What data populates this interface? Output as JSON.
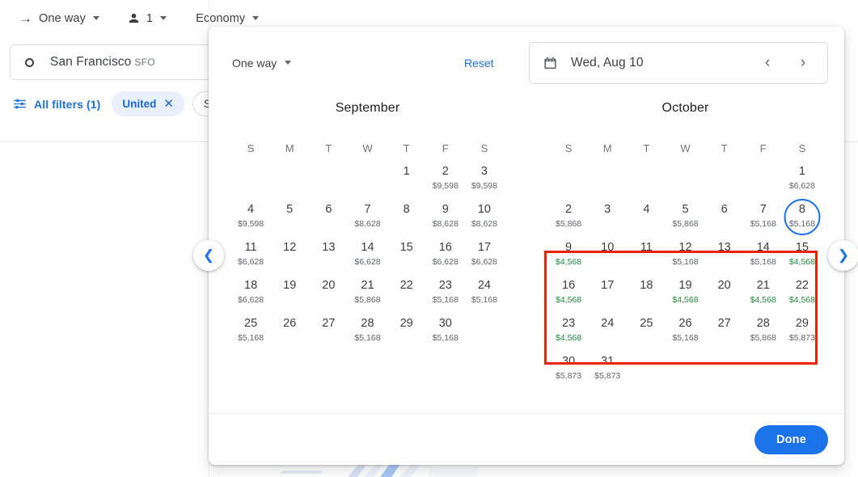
{
  "topbar": {
    "trip_type": "One way",
    "trip_type_icon": "arrow-right-icon",
    "passengers": "1",
    "passengers_icon": "person-icon",
    "cabin_class": "Economy"
  },
  "search": {
    "origin": "San Francisco",
    "origin_code": "SFO",
    "origin_icon": "circle-icon"
  },
  "filters": {
    "icon": "tune-icon",
    "all_filters_label": "All filters (1)",
    "chips": [
      {
        "label": "United",
        "close_icon": "close-icon",
        "active": true
      },
      {
        "label": "S",
        "active": false
      }
    ]
  },
  "dialog": {
    "trip_type": "One way",
    "reset_label": "Reset",
    "date_icon": "calendar-icon",
    "date_value": "Wed, Aug 10",
    "prev_icon": "chevron-left-icon",
    "next_icon": "chevron-right-icon",
    "done_label": "Done",
    "weekdays": [
      "S",
      "M",
      "T",
      "W",
      "T",
      "F",
      "S"
    ],
    "months": [
      {
        "name": "September",
        "lead_blanks": 4,
        "days": [
          {
            "day": "1",
            "price": ""
          },
          {
            "day": "2",
            "price": "$9,598"
          },
          {
            "day": "3",
            "price": "$9,598"
          },
          {
            "day": "4",
            "price": "$9,598"
          },
          {
            "day": "5",
            "price": ""
          },
          {
            "day": "6",
            "price": ""
          },
          {
            "day": "7",
            "price": "$8,628"
          },
          {
            "day": "8",
            "price": ""
          },
          {
            "day": "9",
            "price": "$8,628"
          },
          {
            "day": "10",
            "price": "$8,628"
          },
          {
            "day": "11",
            "price": "$6,628"
          },
          {
            "day": "12",
            "price": ""
          },
          {
            "day": "13",
            "price": ""
          },
          {
            "day": "14",
            "price": "$6,628"
          },
          {
            "day": "15",
            "price": ""
          },
          {
            "day": "16",
            "price": "$6,628"
          },
          {
            "day": "17",
            "price": "$6,628"
          },
          {
            "day": "18",
            "price": "$6,628"
          },
          {
            "day": "19",
            "price": ""
          },
          {
            "day": "20",
            "price": ""
          },
          {
            "day": "21",
            "price": "$5,868"
          },
          {
            "day": "22",
            "price": ""
          },
          {
            "day": "23",
            "price": "$5,168"
          },
          {
            "day": "24",
            "price": "$5,168"
          },
          {
            "day": "25",
            "price": "$5,168"
          },
          {
            "day": "26",
            "price": ""
          },
          {
            "day": "27",
            "price": ""
          },
          {
            "day": "28",
            "price": "$5,168"
          },
          {
            "day": "29",
            "price": ""
          },
          {
            "day": "30",
            "price": "$5,168"
          }
        ]
      },
      {
        "name": "October",
        "lead_blanks": 6,
        "days": [
          {
            "day": "1",
            "price": "$6,628"
          },
          {
            "day": "2",
            "price": "$5,868"
          },
          {
            "day": "3",
            "price": ""
          },
          {
            "day": "4",
            "price": ""
          },
          {
            "day": "5",
            "price": "$5,868"
          },
          {
            "day": "6",
            "price": ""
          },
          {
            "day": "7",
            "price": "$5,168"
          },
          {
            "day": "8",
            "price": "$5,168",
            "selected": true
          },
          {
            "day": "9",
            "price": "$4,568",
            "cheap": true
          },
          {
            "day": "10",
            "price": ""
          },
          {
            "day": "11",
            "price": ""
          },
          {
            "day": "12",
            "price": "$5,168"
          },
          {
            "day": "13",
            "price": ""
          },
          {
            "day": "14",
            "price": "$5,168"
          },
          {
            "day": "15",
            "price": "$4,568",
            "cheap": true
          },
          {
            "day": "16",
            "price": "$4,568",
            "cheap": true
          },
          {
            "day": "17",
            "price": ""
          },
          {
            "day": "18",
            "price": ""
          },
          {
            "day": "19",
            "price": "$4,568",
            "cheap": true
          },
          {
            "day": "20",
            "price": ""
          },
          {
            "day": "21",
            "price": "$4,568",
            "cheap": true
          },
          {
            "day": "22",
            "price": "$4,568",
            "cheap": true
          },
          {
            "day": "23",
            "price": "$4,568",
            "cheap": true
          },
          {
            "day": "24",
            "price": ""
          },
          {
            "day": "25",
            "price": ""
          },
          {
            "day": "26",
            "price": "$5,168"
          },
          {
            "day": "27",
            "price": ""
          },
          {
            "day": "28",
            "price": "$5,868"
          },
          {
            "day": "29",
            "price": "$5,873"
          },
          {
            "day": "30",
            "price": "$5,873"
          },
          {
            "day": "31",
            "price": "$5,873"
          }
        ]
      }
    ]
  },
  "side_nav": {
    "prev_icon": "chevron-left-circle-icon",
    "next_icon": "chevron-right-circle-icon"
  },
  "colors": {
    "accent_blue": "#1a73e8",
    "cheap_green": "#1e8e3e",
    "annotation_red": "#ee2200",
    "chip_bg": "#e8f0fe"
  }
}
